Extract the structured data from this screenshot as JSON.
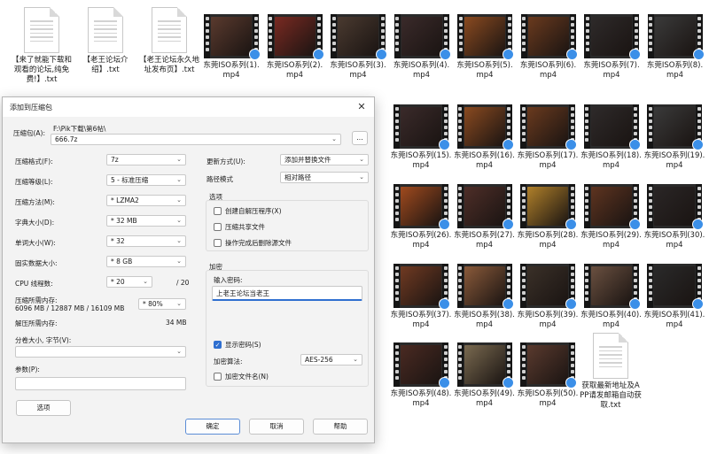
{
  "top_docs": [
    {
      "label": "【来了就能下载和观看的论坛,纯免费!】.txt"
    },
    {
      "label": "【老王论坛介绍】.txt"
    },
    {
      "label": "【老王论坛永久地址发布页】.txt"
    }
  ],
  "row1_videos": [
    "东莞ISO系列(1).mp4",
    "东莞ISO系列(2).mp4",
    "东莞ISO系列(3).mp4",
    "东莞ISO系列(4).mp4",
    "东莞ISO系列(5).mp4",
    "东莞ISO系列(6).mp4",
    "东莞ISO系列(7).mp4",
    "东莞ISO系列(8).mp4"
  ],
  "grid_rows": [
    [
      "东莞ISO系列(15).mp4",
      "东莞ISO系列(16).mp4",
      "东莞ISO系列(17).mp4",
      "东莞ISO系列(18).mp4",
      "东莞ISO系列(19).mp4"
    ],
    [
      "东莞ISO系列(26).mp4",
      "东莞ISO系列(27).mp4",
      "东莞ISO系列(28).mp4",
      "东莞ISO系列(29).mp4",
      "东莞ISO系列(30).mp4"
    ],
    [
      "东莞ISO系列(37).mp4",
      "东莞ISO系列(38).mp4",
      "东莞ISO系列(39).mp4",
      "东莞ISO系列(40).mp4",
      "东莞ISO系列(41).mp4"
    ],
    [
      "东莞ISO系列(48).mp4",
      "东莞ISO系列(49).mp4",
      "东莞ISO系列(50).mp4"
    ]
  ],
  "last_doc": {
    "label": "获取最新地址及APP请发邮箱自动获取.txt"
  },
  "dialog": {
    "title": "添加到压缩包",
    "close": "✕",
    "archive_label": "压缩包(A):",
    "archive_path": "F:\\Pik下载\\第6帖\\",
    "archive_name": "666.7z",
    "browse": "...",
    "format_label": "压缩格式(F):",
    "format_value": "7z",
    "level_label": "压缩等级(L):",
    "level_value": "5 - 标准压缩",
    "method_label": "压缩方法(M):",
    "method_value": "* LZMA2",
    "dict_label": "字典大小(D):",
    "dict_value": "* 32 MB",
    "word_label": "单词大小(W):",
    "word_value": "* 32",
    "solid_label": "固实数据大小:",
    "solid_value": "* 8 GB",
    "cpu_label": "CPU 线程数:",
    "cpu_value": "* 20",
    "cpu_max": "/ 20",
    "mem_label": "压缩所需内存:",
    "mem_value": "6096 MB / 12887 MB / 16109 MB",
    "mem_pct": "* 80%",
    "decomp_label": "解压所需内存:",
    "decomp_value": "34 MB",
    "split_label": "分卷大小, 字节(V):",
    "params_label": "参数(P):",
    "options_button": "选项",
    "update_label": "更新方式(U):",
    "update_value": "添加并替换文件",
    "pathmode_label": "路径模式",
    "pathmode_value": "相对路径",
    "options_group": "选项",
    "opt_sfx": "创建自解压程序(X)",
    "opt_shared": "压缩共享文件",
    "opt_delete": "操作完成后删除源文件",
    "enc_group": "加密",
    "pwd_label": "输入密码:",
    "pwd_value": "上老王论坛当老王",
    "show_pwd": "显示密码(S)",
    "enc_method_label": "加密算法:",
    "enc_method_value": "AES-256",
    "enc_names": "加密文件名(N)",
    "ok": "确定",
    "cancel": "取消",
    "help": "帮助"
  }
}
